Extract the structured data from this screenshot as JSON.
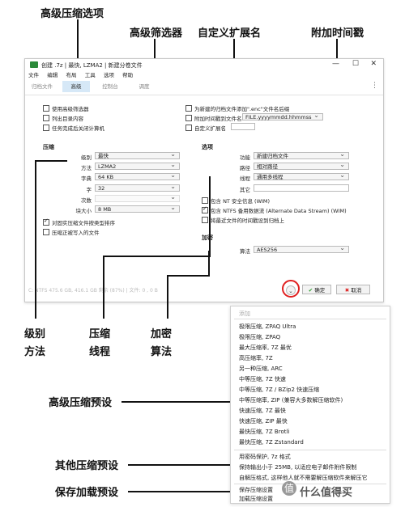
{
  "callouts": {
    "advanced_options": "高级压缩选项",
    "advanced_filter": "高级筛选器",
    "custom_ext": "自定义扩展名",
    "add_timestamp": "附加时间戳",
    "level_method_1": "级别",
    "level_method_2": "方法",
    "compress_thread_1": "压缩",
    "compress_thread_2": "线程",
    "encrypt_1": "加密",
    "encrypt_2": "算法",
    "adv_presets": "高级压缩预设",
    "other_presets": "其他压缩预设",
    "save_load": "保存加载预设"
  },
  "window": {
    "title": "创建 .7z | 最快, LZMA2 | 新建分卷文件",
    "minimize": "—",
    "maximize": "☐",
    "close": "✕",
    "menu": [
      "文件",
      "编辑",
      "布局",
      "工具",
      "选项",
      "帮助"
    ],
    "tabs": [
      "归档文件",
      "高级",
      "控制台",
      "调度"
    ],
    "active_tab": 1,
    "kebab": "⋮"
  },
  "options_top": {
    "use_filter": "使用高级筛选器",
    "list_dirs": "列出目录内容",
    "shutdown": "任务完成后关闭计算机",
    "unique_name": "为新建的归档文件添加\".enc\"文件名后缀",
    "append_time": "附加时间戳到文件名",
    "time_format": "FILE.yyyymmdd.hhmmss",
    "custom_ext": "自定义扩展名"
  },
  "compress": {
    "header": "压缩",
    "level_label": "级别",
    "level_value": "最快",
    "method_label": "方法",
    "method_value": "LZMA2",
    "dict_label": "字典",
    "dict_value": "64 KB",
    "word_label": "字",
    "word_value": "32",
    "passes_label": "次数",
    "passes_value": "",
    "block_label": "块大小",
    "block_value": "8 MB",
    "solid_sort": "对固实压缩文件按类型排序",
    "compress_open": "压缩正被写入的文件"
  },
  "options": {
    "header": "选项",
    "func_label": "功能",
    "func_value": "新建归档文件",
    "path_label": "路径",
    "path_value": "相对路径",
    "thread_label": "线程",
    "thread_value": "通用多线程",
    "other_label": "其它",
    "other_value": "",
    "nt_security": "包含 NT 安全信息 (WIM)",
    "ntfs_streams": "包含 NTFS 备用数据流 (Alternate Data Stream) (WIM)",
    "latest_time": "将最近文件的时间戳设到归档上"
  },
  "encrypt": {
    "header": "加密",
    "algo_label": "算法",
    "algo_value": "AES256"
  },
  "status": "C: NTFS 475.6 GB, 416.1 GB 剩余 (87%) | 文件: 0 , 0 B",
  "buttons": {
    "chevron": "⌄",
    "ok": "确定",
    "cancel": "取消"
  },
  "menu": {
    "header": "添加",
    "group1": [
      "极限压缩, ZPAQ Ultra",
      "极限压缩, ZPAQ",
      "最大压缩率, 7Z 最优",
      "高压缩率, 7Z",
      "另一种压缩, ARC",
      "中等压缩, 7Z 快速",
      "中等压缩, 7Z / BZip2 快速压缩",
      "中等压缩率, ZIP (兼容大多数解压缩软件)",
      "快速压缩, 7Z 最快",
      "快速压缩, ZIP 最快",
      "最快压缩, 7Z Brotli",
      "最快压缩, 7Z Zstandard"
    ],
    "group2": [
      "用密码保护, 7z 格式",
      "保持输出小于 25MB, 以适应电子邮件附件限制",
      "自解压格式, 这样他人就不需要解压缩软件来解压它"
    ],
    "group3": [
      "保存压缩设置",
      "加载压缩设置"
    ]
  },
  "watermark": {
    "logo": "值",
    "text": "什么值得买"
  }
}
